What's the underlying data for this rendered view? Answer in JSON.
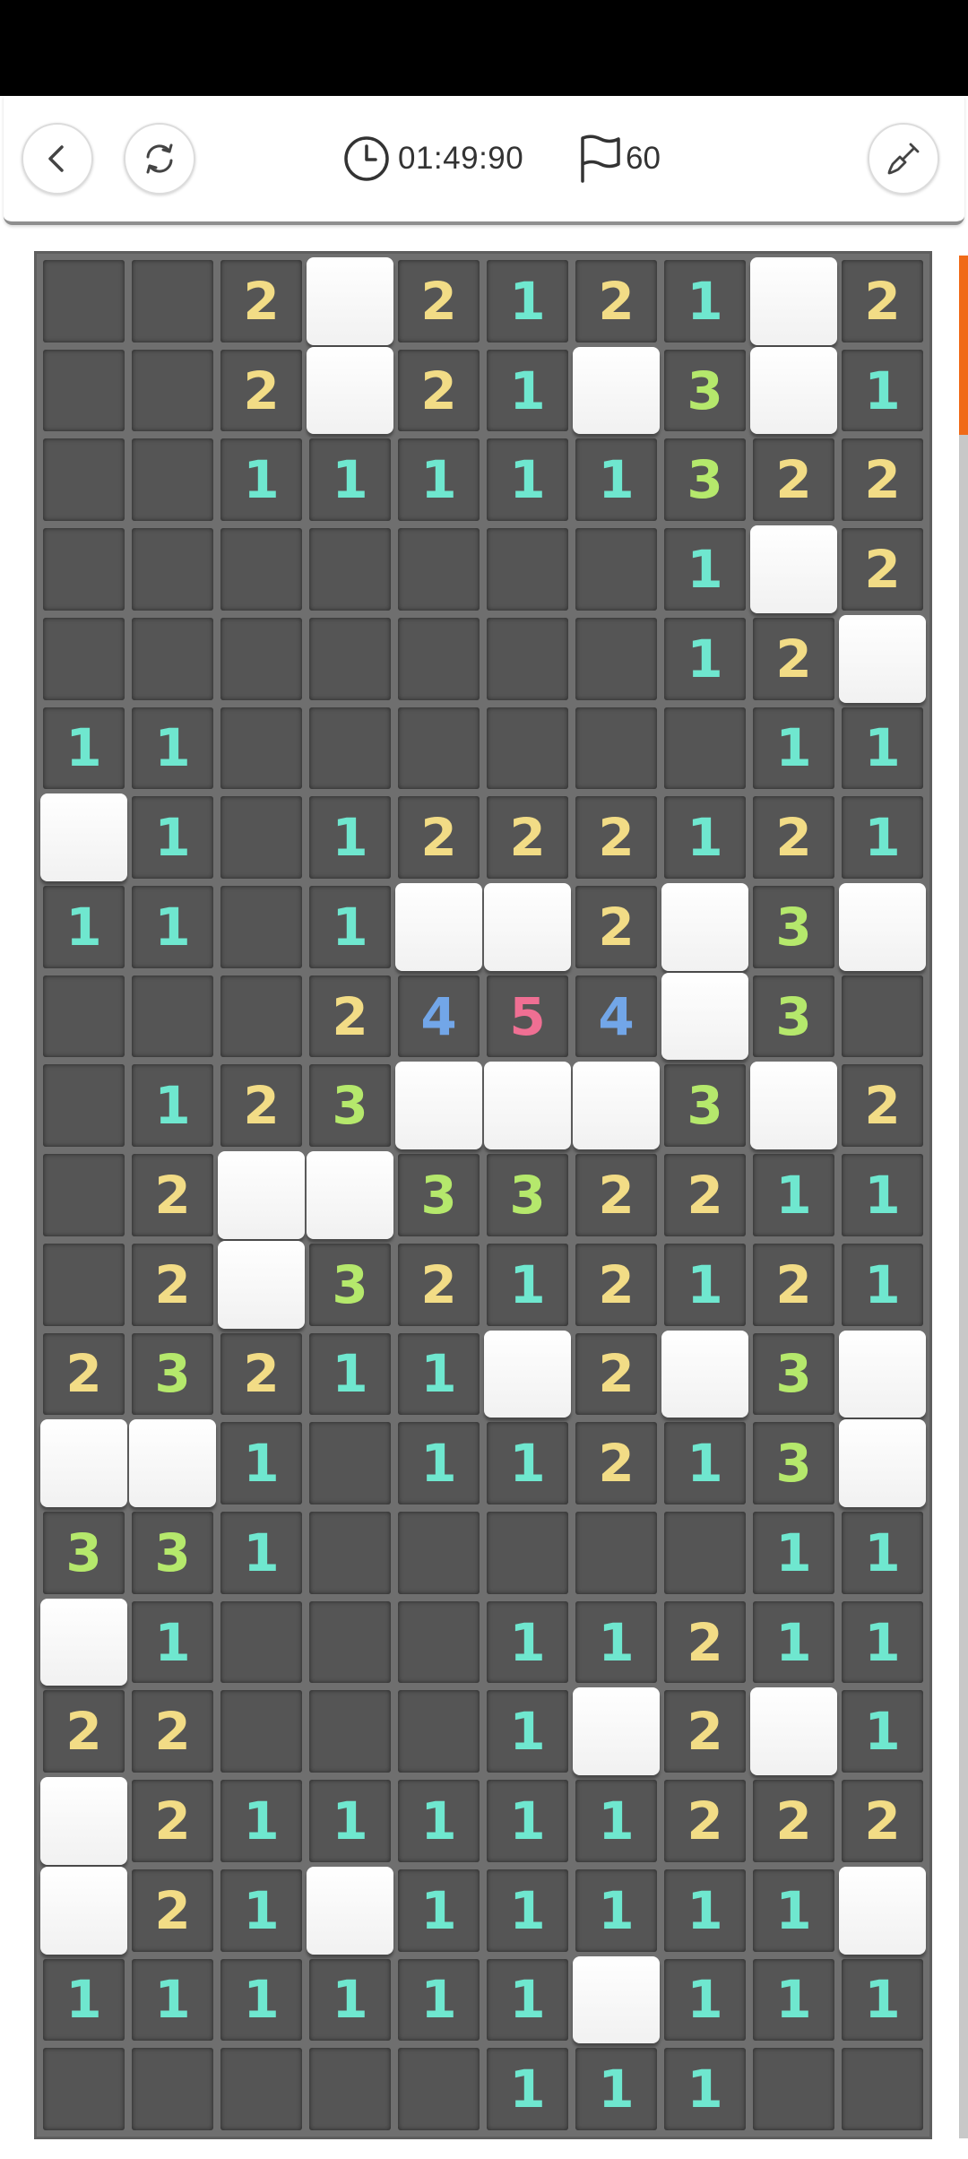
{
  "header": {
    "timer": "01:49:90",
    "flags": "60",
    "icons": {
      "back": "back-chevron-icon",
      "restart": "restart-icon",
      "timer": "clock-icon",
      "flag": "flag-icon",
      "mode": "shovel-icon"
    }
  },
  "board": {
    "columns": 10,
    "rows": 21,
    "legend": "Each row string: '.' = revealed empty, '#' = unrevealed tile, digit = adjacent mine count",
    "cells": [
      "..2#2121#21",
      "..2#21#3#1",
      "..11111322",
      ".......1#2",
      ".......12#",
      "11......11",
      "#1.1222121",
      "11.1##2#3#",
      "...2454#3",
      ".123###3#2",
      ".2##332211",
      ".2#3212121",
      "23211#2#3#",
      "##1.11213#",
      "331.....11",
      "#1...11211",
      "22...1#2#1",
      "#211111222",
      "#21#11111#",
      "111111#111",
      ".....111.."
    ]
  },
  "colors": {
    "1": "#6fe7cf",
    "2": "#f2dc86",
    "3": "#b5e86c",
    "4": "#72a6e8",
    "5": "#ef6f93",
    "accent": "#f06a18"
  },
  "scroll_position": 0.0
}
